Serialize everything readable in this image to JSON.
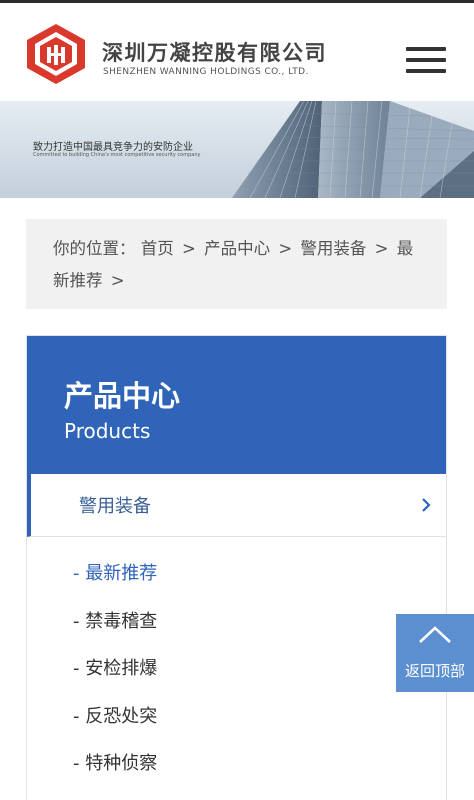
{
  "header": {
    "company_cn": "深圳万凝控股有限公司",
    "company_en": "SHENZHEN WANNING HOLDINGS CO., LTD.",
    "logo_icon": "stacked-block-logo-icon",
    "menu_icon": "hamburger-menu-icon"
  },
  "banner": {
    "slogan": "致力打造中国最具竞争力的安防企业",
    "subtitle": "Committed to building China's most competitive security company"
  },
  "breadcrumb": {
    "prefix": "你的位置：",
    "items": [
      "首页",
      "产品中心",
      "警用装备",
      "最新推荐"
    ],
    "separator": ">"
  },
  "product_center": {
    "title": "产品中心",
    "title_en": "Products",
    "category": "警用装备",
    "subcategories": [
      "- 最新推荐",
      "- 禁毒稽查",
      "- 安检排爆",
      "- 反恐处突",
      "- 特种侦察"
    ],
    "active_index": 0
  },
  "back_to_top": {
    "label": "返回顶部",
    "icon": "chevron-up-icon"
  },
  "colors": {
    "primary_blue": "#3064b9",
    "back_top_blue": "#5b8fd0",
    "logo_red": "#d9382c",
    "crumb_bg": "#f1f1f1"
  }
}
